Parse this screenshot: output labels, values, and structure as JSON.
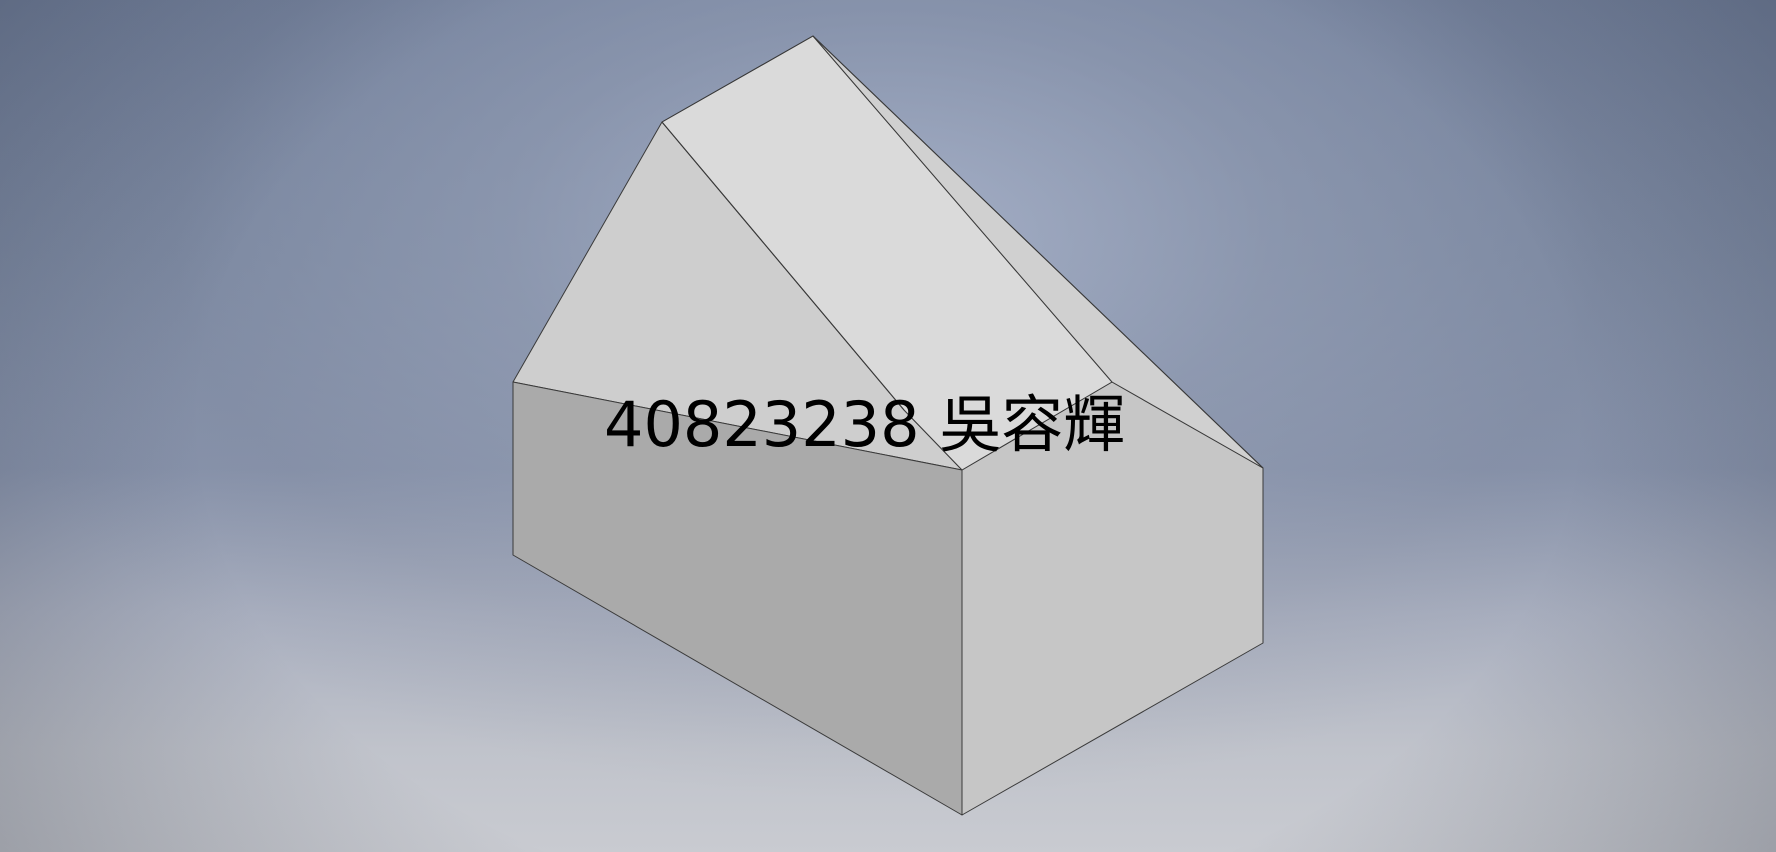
{
  "viewport": {
    "overlay_text": "40823238 吳容輝"
  },
  "model": {
    "type": "3D solid – house-shaped prism (isometric shaded view)",
    "faces": [
      "front-face",
      "right-gable-face",
      "left-roof-face",
      "top-roof-face",
      "right-roof-face"
    ]
  },
  "colors": {
    "front_face": "#aaaaaa",
    "right_gable_face": "#c6c6c6",
    "left_roof_face": "#cecece",
    "top_roof_face": "#dadada",
    "right_roof_face": "#d0d0d0",
    "edge": "#3a3a3a",
    "label": "#000000"
  }
}
